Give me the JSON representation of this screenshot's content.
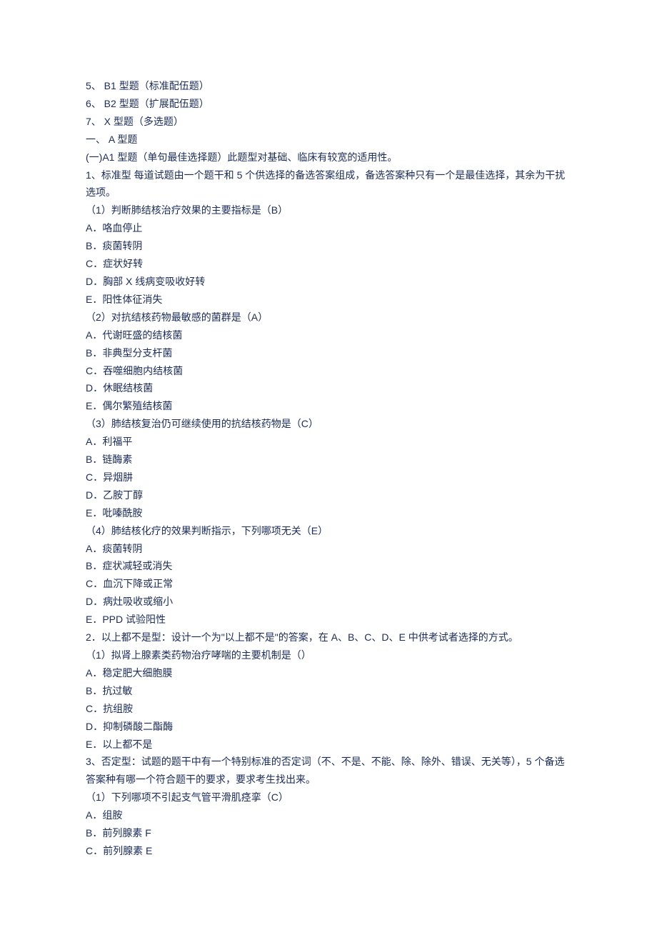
{
  "lines": [
    "5、 B1 型题（标准配伍题）",
    "6、 B2 型题（扩展配伍题）",
    "7、 X 型题（多选题）",
    "一、 A 型题",
    "(一)A1 型题（单句最佳选择题）此题型对基础、临床有较宽的适用性。",
    "1、标准型 每道试题由一个题干和 5 个供选择的备选答案组成，备选答案种只有一个是最佳选择，其余为干扰选项。",
    "（1）判断肺结核治疗效果的主要指标是（B）",
    "A．咯血停止",
    "B．痰菌转阴",
    "C．症状好转",
    "D．胸部 X 线病变吸收好转",
    "E．阳性体征消失",
    "（2）对抗结核药物最敏感的菌群是（A）",
    "A．代谢旺盛的结核菌",
    "B．非典型分支杆菌",
    "C．吞噬细胞内结核菌",
    "D．休眠结核菌",
    "E．偶尔繁殖结核菌",
    "（3）肺结核复治仍可继续使用的抗结核药物是（C）",
    "A．利福平",
    "B．链酶素",
    "C．异烟肼",
    "D．乙胺丁醇",
    "E．吡嗪酰胺",
    "（4）肺结核化疗的效果判断指示，下列哪项无关（E）",
    "A．痰菌转阴",
    "B．症状减轻或消失",
    "C．血沉下降或正常",
    "D．病灶吸收或缩小",
    "E．PPD 试验阳性",
    "2．以上都不是型：设计一个为\"以上都不是\"的答案，在 A、B、C、D、E 中供考试者选择的方式。",
    "（1）拟肾上腺素类药物治疗哮喘的主要机制是（）",
    "A．稳定肥大细胞膜",
    "B．抗过敏",
    "C．抗组胺",
    "D．抑制磷酸二酯酶",
    "E．以上都不是",
    "3、否定型：试题的题干中有一个特别标准的否定词（不、不是、不能、除、除外、错误、无关等），5 个备选答案种有哪一个符合题干的要求，要求考生找出来。",
    "（1）下列哪项不引起支气管平滑肌痉挛（C）",
    "A．组胺",
    "B．前列腺素 F",
    "C．前列腺素 E"
  ]
}
